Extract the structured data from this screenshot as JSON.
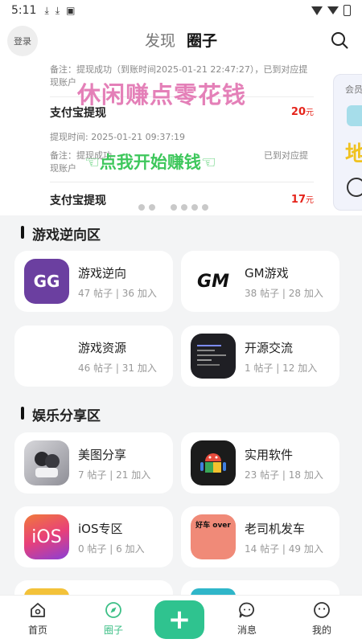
{
  "status_bar": {
    "time": "5:11",
    "icons": [
      "download-icon",
      "download-icon",
      "text-icon",
      "wifi-icon",
      "signal-icon",
      "battery-icon"
    ]
  },
  "header": {
    "login_label": "登录",
    "tabs": [
      {
        "label": "发现",
        "active": false
      },
      {
        "label": "圈子",
        "active": true
      }
    ],
    "search_icon": "search-icon"
  },
  "banner": {
    "top_note": "备注：提现成功（到账时间2025-01-21 22:47:27），已到对应提现账户",
    "records": [
      {
        "name": "支付宝提现",
        "amount": "20",
        "unit": "元",
        "time": "提现时间: 2025-01-21 09:37:19",
        "note_line1": "备注：提现成功",
        "note_tail": "已到对应提",
        "note_line2": "现账户"
      },
      {
        "name": "支付宝提现",
        "amount": "17",
        "unit": "元"
      }
    ],
    "overlay_text_1": "休闲赚点零花钱",
    "overlay_text_2": "☜点我开始赚钱☜",
    "side_card_label": "会员",
    "side_card_char": "地",
    "page_dots": 6
  },
  "sections": [
    {
      "title": "游戏逆向区",
      "items": [
        {
          "name": "游戏逆向",
          "stats": "47 帖子 | 36 加入",
          "icon": "game-guardian-icon",
          "icon_text": "GG",
          "icon_bg": "#6b3fa0",
          "icon_fg": "#ffffff"
        },
        {
          "name": "GM游戏",
          "stats": "38 帖子 | 28 加入",
          "icon": "gm-logo-icon",
          "icon_text": "GM",
          "icon_bg": "#ffffff",
          "icon_fg": "#111111"
        },
        {
          "name": "游戏资源",
          "stats": "46 帖子 | 31 加入",
          "icon": "blank-icon",
          "icon_text": "",
          "icon_bg": "#ffffff",
          "icon_fg": "#111111"
        },
        {
          "name": "开源交流",
          "stats": "1 帖子 | 12 加入",
          "icon": "terminal-icon",
          "icon_text": "",
          "icon_bg": "#1f1f24",
          "icon_fg": "#ffffff"
        }
      ]
    },
    {
      "title": "娱乐分享区",
      "items": [
        {
          "name": "美图分享",
          "stats": "7 帖子 | 21 加入",
          "icon": "anime-image-icon",
          "icon_text": "",
          "icon_bg": "#c8c8cc",
          "icon_fg": "#111111"
        },
        {
          "name": "实用软件",
          "stats": "23 帖子 | 18 加入",
          "icon": "android-icon",
          "icon_text": "",
          "icon_bg": "#1b1b1b",
          "icon_fg": "#ffffff"
        },
        {
          "name": "iOS专区",
          "stats": "0 帖子 | 6 加入",
          "icon": "ios-icon",
          "icon_text": "iOS",
          "icon_bg": "#e84a7a",
          "icon_fg": "#ffffff"
        },
        {
          "name": "老司机发车",
          "stats": "14 帖子 | 49 加入",
          "icon": "panda-meme-icon",
          "icon_text": "好车 over",
          "icon_bg": "#f08a78",
          "icon_fg": "#111111"
        }
      ]
    }
  ],
  "bottom_nav": [
    {
      "label": "首页",
      "icon": "home-icon",
      "active": false
    },
    {
      "label": "圈子",
      "icon": "compass-icon",
      "active": true
    },
    {
      "label": "",
      "icon": "plus-icon",
      "active": false
    },
    {
      "label": "消息",
      "icon": "message-icon",
      "active": false
    },
    {
      "label": "我的",
      "icon": "smile-icon",
      "active": false
    }
  ],
  "colors": {
    "accent": "#2fc38f",
    "amount_red": "#e5241b",
    "overlay_pink": "#e480b8",
    "overlay_green": "#3ec75c"
  }
}
